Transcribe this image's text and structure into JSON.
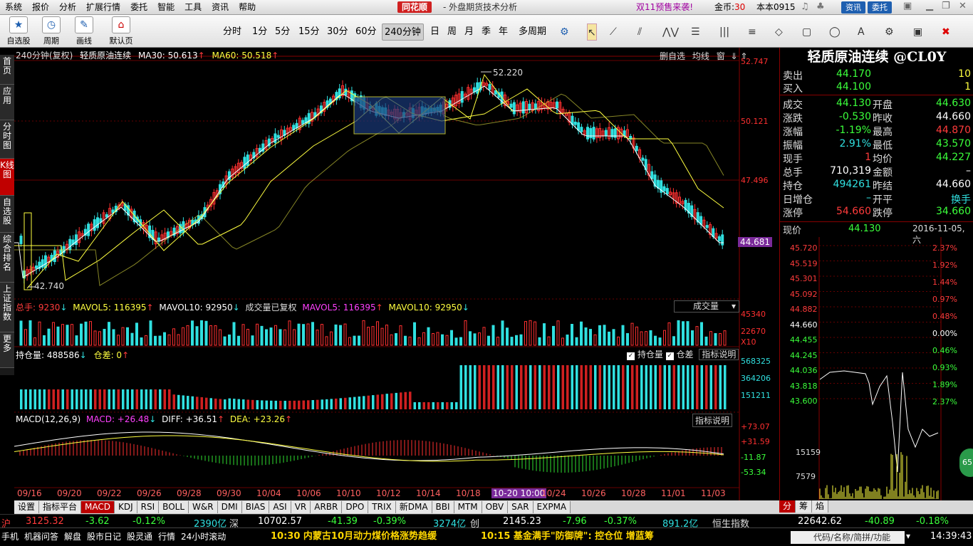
{
  "menu": [
    "系统",
    "报价",
    "分析",
    "扩展行情",
    "委托",
    "智能",
    "工具",
    "资讯",
    "帮助"
  ],
  "brand": "同花顺",
  "subtitle": "- 外盘期货技术分析",
  "promo": "双11预售来袭!",
  "coin": {
    "label": "金币:",
    "value": "30"
  },
  "version": "本本0915",
  "top_buttons": [
    {
      "label": "资讯",
      "color": "#1e5fb0"
    },
    {
      "label": "委托",
      "color": "#1e5fb0"
    }
  ],
  "toolbar": {
    "tools": [
      {
        "label": "自选股",
        "icon": "star-icon"
      },
      {
        "label": "周期",
        "icon": "clock-icon"
      },
      {
        "label": "画线",
        "icon": "pencil-icon"
      },
      {
        "label": "默认页",
        "icon": "home-icon"
      }
    ],
    "periods": [
      "分时",
      "1分",
      "5分",
      "15分",
      "30分",
      "60分",
      "240分钟",
      "日",
      "周",
      "月",
      "季",
      "年",
      "多周期"
    ],
    "active_period": "240分钟"
  },
  "left_tabs": [
    "首页",
    "应用",
    "分时图",
    "K线图",
    "自选股",
    "综合排名",
    "上证指数",
    "更多"
  ],
  "active_left_tab": "K线图",
  "chart": {
    "header": {
      "period": "240分钟(复权)",
      "name": "轻质原油连续",
      "ma30_label": "MA30: 50.613",
      "ma60_label": "MA60: 50.518"
    },
    "header_buttons": [
      "删自选",
      "均线",
      "窗"
    ],
    "price_axis": [
      "52.747",
      "50.121",
      "47.496",
      "44.681"
    ],
    "high_annot": "52.220",
    "low_annot": "42.740",
    "volume": {
      "total": "总手: 9230",
      "mavol5": "MAVOL5: 116395",
      "mavol10": "MAVOL10: 92950",
      "adj": "成交量已复权",
      "mavol5b": "MAVOL5: 116395",
      "mavol10b": "MAVOL10: 92950",
      "select": "成交量",
      "axis": [
        "45340",
        "22670",
        "X10"
      ]
    },
    "oi": {
      "label": "持仓量: 488586",
      "diff": "仓差: 0",
      "check1": "持仓量",
      "check2": "仓差",
      "btn": "指标说明",
      "axis": [
        "568325",
        "364206",
        "151211"
      ]
    },
    "macd": {
      "label": "MACD(12,26,9)",
      "macd": "MACD: +26.48",
      "diff": "DIFF: +36.51",
      "dea": "DEA: +23.26",
      "btn": "指标说明",
      "axis": [
        "+73.07",
        "+31.59",
        "-11.87",
        "-53.34"
      ]
    },
    "dates": [
      "09/16",
      "09/20",
      "09/22",
      "09/26",
      "09/28",
      "09/30",
      "10/04",
      "10/06",
      "10/10",
      "10/12",
      "10/14",
      "10/18",
      "10-20 10:00",
      "10/24",
      "10/26",
      "10/28",
      "11/01",
      "11/03"
    ]
  },
  "right_panel": {
    "title": "轻质原油连续 @CL0Y",
    "sell": {
      "label": "卖出",
      "price": "44.170",
      "qty": "10"
    },
    "buy": {
      "label": "买入",
      "price": "44.100",
      "qty": "1"
    },
    "rows": [
      {
        "k": "成交",
        "v": "44.130",
        "vc": "grn",
        "k2": "开盘",
        "v2": "44.630",
        "v2c": "grn"
      },
      {
        "k": "涨跌",
        "v": "-0.530",
        "vc": "grn",
        "k2": "昨收",
        "v2": "44.660",
        "v2c": "wht"
      },
      {
        "k": "涨幅",
        "v": "-1.19%",
        "vc": "grn",
        "k2": "最高",
        "v2": "44.870",
        "v2c": "red"
      },
      {
        "k": "振幅",
        "v": "2.91%",
        "vc": "cyn",
        "k2": "最低",
        "v2": "43.570",
        "v2c": "grn"
      },
      {
        "k": "现手",
        "v": "1",
        "vc": "red",
        "k2": "均价",
        "v2": "44.227",
        "v2c": "grn"
      },
      {
        "k": "总手",
        "v": "710,319",
        "vc": "wht",
        "k2": "金额",
        "v2": "–",
        "v2c": "wht"
      },
      {
        "k": "持仓",
        "v": "494261",
        "vc": "cyn",
        "k2": "昨结",
        "v2": "44.660",
        "v2c": "wht"
      },
      {
        "k": "日增仓",
        "v": "–",
        "vc": "cyn",
        "k2": "开平",
        "v2": "换手",
        "v2c": "cyn"
      },
      {
        "k": "涨停",
        "v": "54.660",
        "vc": "red",
        "k2": "跌停",
        "v2": "34.660",
        "v2c": "grn"
      }
    ],
    "now": {
      "label": "现价",
      "price": "44.130",
      "date": "2016-11-05,六"
    },
    "price_axis": [
      "45.720",
      "45.519",
      "45.301",
      "45.092",
      "44.882",
      "44.660",
      "44.455",
      "44.245",
      "44.036",
      "43.818",
      "43.600"
    ],
    "pct_axis": [
      "2.37%",
      "1.92%",
      "1.44%",
      "0.97%",
      "0.48%",
      "0.00%",
      "0.46%",
      "0.93%",
      "1.89%",
      "2.37%"
    ],
    "vol_axis": [
      "15159",
      "7579"
    ],
    "tabs": [
      "分",
      "筹",
      "焰"
    ],
    "badge": "65"
  },
  "bottom_tabs": [
    "设置",
    "指标平台",
    "MACD",
    "KDJ",
    "RSI",
    "BOLL",
    "W&R",
    "DMI",
    "BIAS",
    "ASI",
    "VR",
    "ARBR",
    "DPO",
    "TRIX",
    "新DMA",
    "BBI",
    "MTM",
    "OBV",
    "SAR",
    "EXPMA"
  ],
  "active_bottom_tab": "MACD",
  "indexbar": [
    {
      "t": "沪",
      "c": "#ff3b3b"
    },
    {
      "t": "3125.32",
      "c": "#ff3b3b"
    },
    {
      "t": "-3.62",
      "c": "#3bff3b"
    },
    {
      "t": "-0.12%",
      "c": "#3bff3b"
    },
    {
      "t": "2390亿",
      "c": "#30e0e0"
    },
    {
      "t": "深",
      "c": "#ddd"
    },
    {
      "t": "10702.57",
      "c": "#fff"
    },
    {
      "t": "-41.39",
      "c": "#3bff3b"
    },
    {
      "t": "-0.39%",
      "c": "#3bff3b"
    },
    {
      "t": "3274亿",
      "c": "#30e0e0"
    },
    {
      "t": "创",
      "c": "#ddd"
    },
    {
      "t": "2145.23",
      "c": "#fff"
    },
    {
      "t": "-7.96",
      "c": "#3bff3b"
    },
    {
      "t": "-0.37%",
      "c": "#3bff3b"
    },
    {
      "t": "891.2亿",
      "c": "#30e0e0"
    },
    {
      "t": "恒生指数",
      "c": "#ddd"
    },
    {
      "t": "22642.62",
      "c": "#fff"
    },
    {
      "t": "-40.89",
      "c": "#3bff3b"
    },
    {
      "t": "-0.18%",
      "c": "#3bff3b"
    }
  ],
  "statusbar": {
    "links": [
      "手机",
      "机器问答",
      "解盘",
      "股市日记",
      "股灵通",
      "行情",
      "24小时滚动"
    ],
    "news1": "10:30 内蒙古10月动力煤价格涨势趋缓",
    "news2": "10:15 基金满手\"防御牌\": 控仓位 增蓝筹",
    "search": "代码/名称/简拼/功能",
    "time": "14:39:43"
  }
}
